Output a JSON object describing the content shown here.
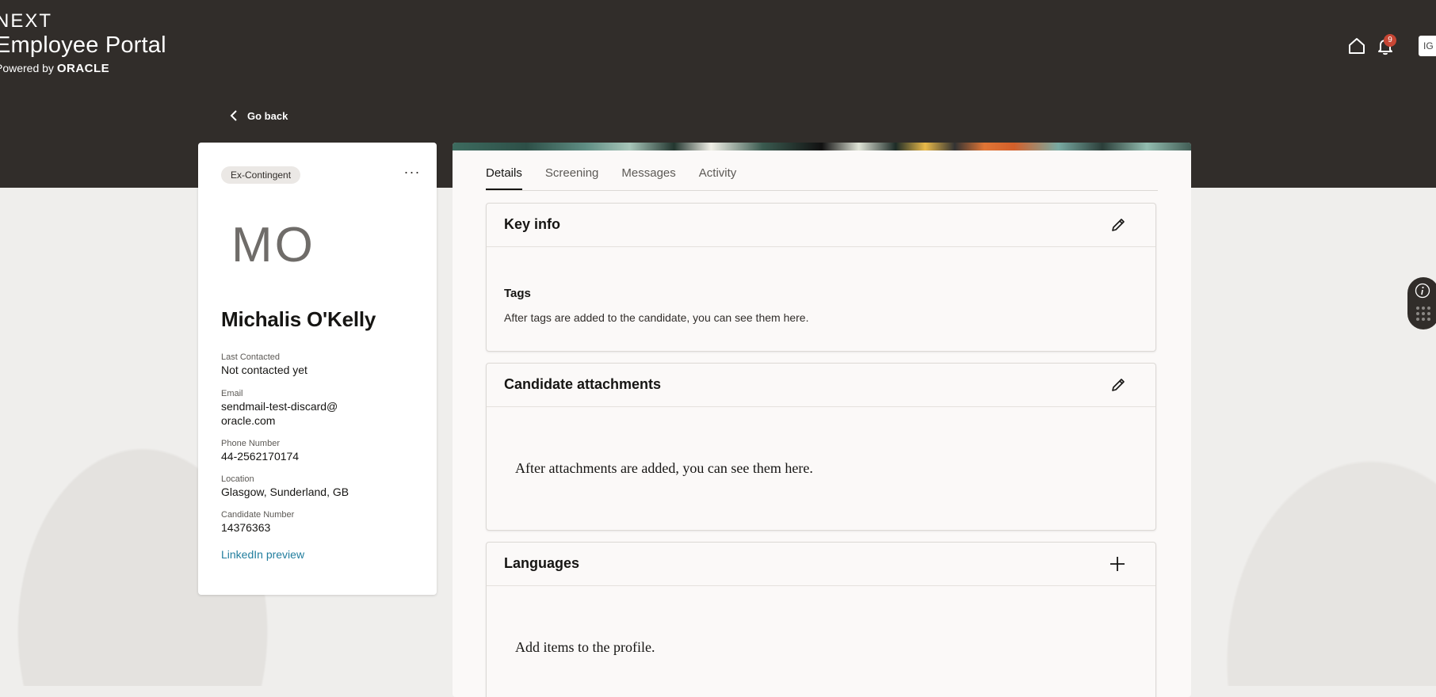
{
  "header": {
    "brand_line1": "NEXT",
    "brand_line2": "Employee Portal",
    "brand_line3_prefix": "Powered by ",
    "brand_line3_logo": "ORACLE",
    "notifications_count": "9",
    "user_initials": "IG",
    "icons": [
      "home-icon",
      "bell-icon"
    ]
  },
  "nav": {
    "go_back": "Go back"
  },
  "candidate": {
    "status_chip": "Ex-Contingent",
    "more_label": "···",
    "initials": "MO",
    "name": "Michalis O'Kelly",
    "fields": [
      {
        "label": "Last Contacted",
        "value": "Not contacted yet"
      },
      {
        "label": "Email",
        "value": "sendmail-test-discard@oracle.com"
      },
      {
        "label": "Phone Number",
        "value": "44-2562170174"
      },
      {
        "label": "Location",
        "value": "Glasgow, Sunderland, GB"
      },
      {
        "label": "Candidate Number",
        "value": "14376363"
      }
    ],
    "linkedin": "LinkedIn preview"
  },
  "tabs": [
    "Details",
    "Screening",
    "Messages",
    "Activity"
  ],
  "active_tab": "Details",
  "sections": {
    "key_info": {
      "title": "Key info",
      "tags_label": "Tags",
      "tags_text": "After tags are added to the candidate, you can see them here.",
      "action_icon": "pencil-icon"
    },
    "attachments": {
      "title": "Candidate attachments",
      "empty": "After attachments are added, you can see them here.",
      "action_icon": "pencil-icon"
    },
    "languages": {
      "title": "Languages",
      "empty": "Add items to the profile.",
      "action_icon": "plus-icon"
    }
  },
  "colors": {
    "header_bg": "#312d2a",
    "badge": "#c74634",
    "link": "#227e9e",
    "page_bg": "#efeeec"
  }
}
